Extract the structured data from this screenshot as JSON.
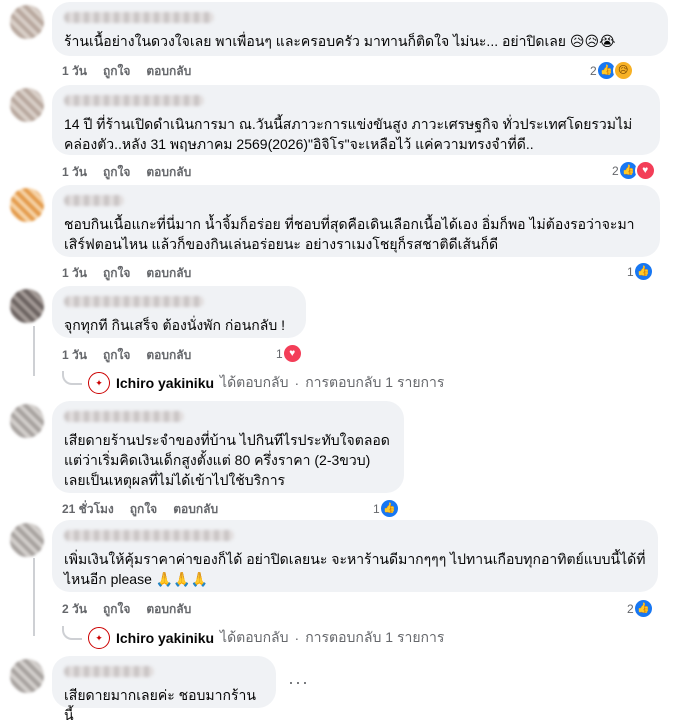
{
  "comments": [
    {
      "text": "ร้านเนื้อย่างในดวงใจเลย พาเพื่อนๆ และครอบครัว มาทานก็ติดใจ ไม่นะ... อย่าปิดเลย 😥😥😭",
      "time": "1 วัน",
      "like": "ถูกใจ",
      "reply": "ตอบกลับ",
      "reaction_count": "2",
      "reaction_icons": [
        "like-icon",
        "sad-icon"
      ]
    },
    {
      "text": "14 ปี ที่ร้านเปิดดำเนินการมา ณ.วันนี้สภาวะการแข่งขันสูง ภาวะเศรษฐกิจ ทั่วประเทศโดยรวมไม่คล่องตัว..หลัง 31 พฤษภาคม 2569(2026)\"อิจิโร\"จะเหลือไว้ แค่ความทรงจำที่ดี..",
      "time": "1 วัน",
      "like": "ถูกใจ",
      "reply": "ตอบกลับ",
      "reaction_count": "2",
      "reaction_icons": [
        "like-icon",
        "love-icon"
      ]
    },
    {
      "text": "ชอบกินเนื้อแกะที่นี่มาก น้ำจิ้มก็อร่อย ที่ชอบที่สุดคือเดินเลือกเนื้อได้เอง อิ่มก็พอ ไม่ต้องรอว่าจะมาเสิร์ฟตอนไหน แล้วก็ของกินเล่นอร่อยนะ อย่างราเมงโชยุก็รสชาติดีเส้นก็ดี",
      "time": "1 วัน",
      "like": "ถูกใจ",
      "reply": "ตอบกลับ",
      "reaction_count": "1",
      "reaction_icons": [
        "like-icon"
      ]
    },
    {
      "text": "จุกทุกที กินเสร็จ ต้องนั่งพัก ก่อนกลับ !",
      "time": "1 วัน",
      "like": "ถูกใจ",
      "reply": "ตอบกลับ",
      "reaction_count": "1",
      "reaction_icons": [
        "love-icon"
      ],
      "replies": {
        "author": "Ichiro yakiniku",
        "action": "ได้ตอบกลับ",
        "sep": "·",
        "summary": "การตอบกลับ 1 รายการ"
      }
    },
    {
      "text": "เสียดายร้านประจำของที่บ้าน ไปกินทีไรประทับใจตลอด\nแต่ว่าเริ่มคิดเงินเด็กสูงตั้งแต่ 80 ครึ่งราคา (2-3ขวบ)\nเลยเป็นเหตุผลที่ไม่ได้เข้าไปใช้บริการ",
      "time": "21 ชั่วโมง",
      "like": "ถูกใจ",
      "reply": "ตอบกลับ",
      "reaction_count": "1",
      "reaction_icons": [
        "like-icon"
      ]
    },
    {
      "text": "เพิ่มเงินให้คุ้มราคาค่าของก็ได้ อย่าปิดเลยนะ จะหาร้านดีมากๆๆๆ ไปทานเกือบทุกอาทิตย์แบบนี้ได้ที่ไหนอีก please 🙏🙏🙏",
      "time": "2 วัน",
      "like": "ถูกใจ",
      "reply": "ตอบกลับ",
      "reaction_count": "2",
      "reaction_icons": [
        "like-icon"
      ],
      "replies": {
        "author": "Ichiro yakiniku",
        "action": "ได้ตอบกลับ",
        "sep": "·",
        "summary": "การตอบกลับ 1 รายการ"
      }
    },
    {
      "text": "เสียดายมากเลยค่ะ ชอบมากร้านนี้",
      "more": "···"
    }
  ]
}
